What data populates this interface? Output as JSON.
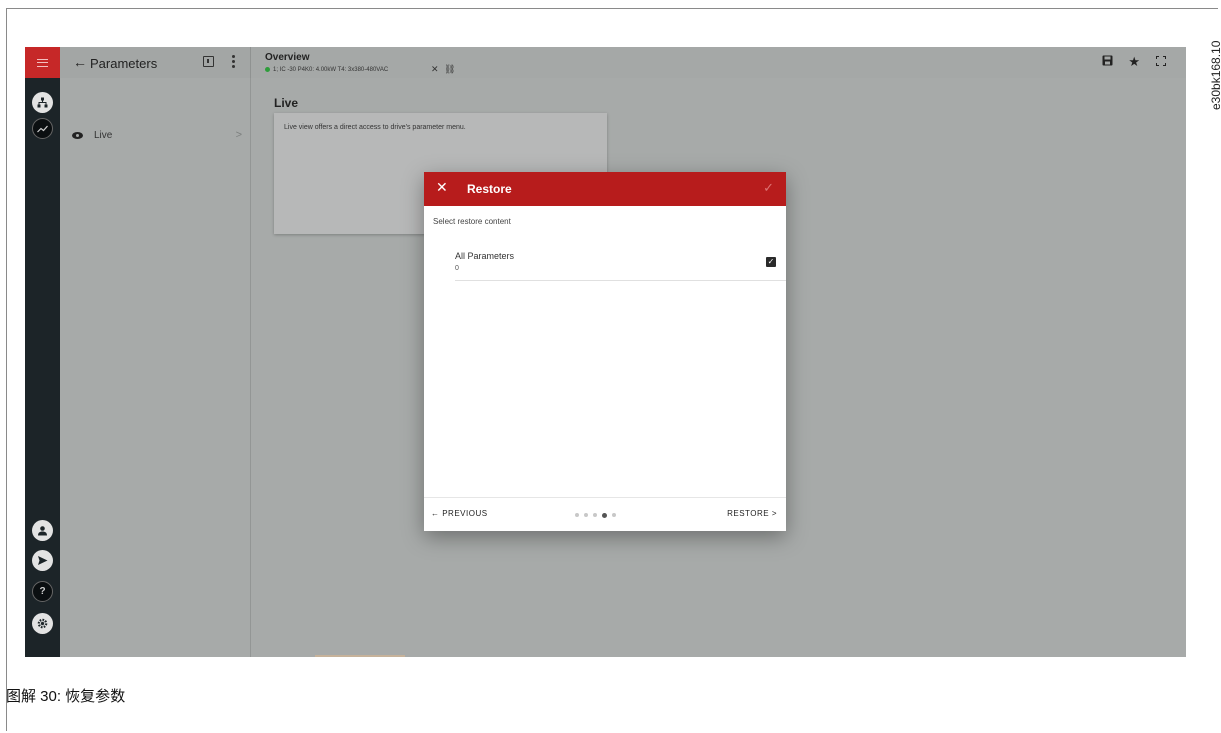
{
  "topbar_left": {
    "back_arrow": "←",
    "title": "Parameters"
  },
  "sidebar": {
    "items": [
      {
        "label": "Live",
        "chevron": ">"
      }
    ]
  },
  "overview": {
    "title": "Overview",
    "drive_info": "1; IC -30 P4K0: 4.00kW T4: 3x380-480VAC",
    "close_glyph": "✕",
    "link_glyph": "⛓"
  },
  "main": {
    "section_title": "Live",
    "card_text": "Live view offers a direct access to drive's parameter menu."
  },
  "dialog": {
    "title": "Restore",
    "close_glyph": "✕",
    "confirm_glyph": "✓",
    "subtitle": "Select restore content",
    "option_label": "All Parameters",
    "option_value": "0",
    "checkbox_glyph": "✓",
    "option_checked": true,
    "previous_label": "← PREVIOUS",
    "restore_label": "RESTORE >",
    "step_count": 5,
    "active_step": 4
  },
  "figure": {
    "caption": "图解 30: 恢复参数",
    "figure_id": "e30bk168.10"
  }
}
